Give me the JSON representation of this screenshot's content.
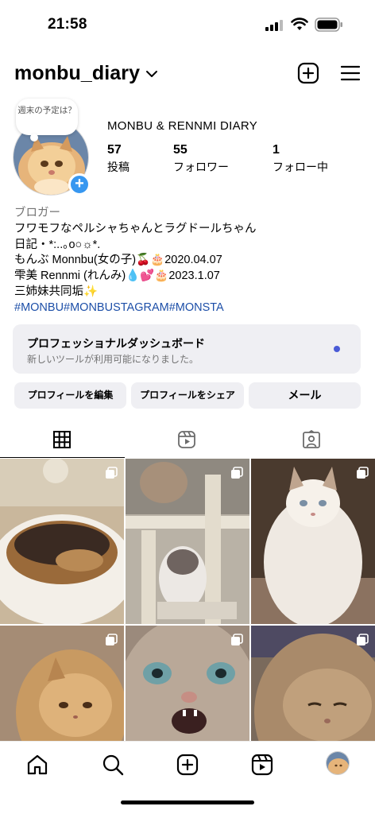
{
  "status_bar": {
    "time": "21:58",
    "icons": [
      "cellular-signal-icon",
      "wifi-icon",
      "battery-icon"
    ]
  },
  "header": {
    "username": "monbu_diary",
    "icons": [
      "chevron-down-icon",
      "plus-square-icon",
      "hamburger-menu-icon"
    ]
  },
  "profile": {
    "note": "週末の予定は？",
    "display_name": "MONBU & RENNMI DIARY",
    "stats": [
      {
        "value": "57",
        "label": "投稿"
      },
      {
        "value": "55",
        "label": "フォロワー"
      },
      {
        "value": "1",
        "label": "フォロー中"
      }
    ]
  },
  "bio": {
    "category": "ブロガー",
    "lines": [
      "フワモフなペルシャちゃんとラグドールちゃん",
      "日記・*:..｡o○☼*.",
      "もんぶ Monnbu(女の子)🍒🎂2020.04.07",
      "雫美 Rennmi (れんみ)💧💕🎂2023.1.07",
      "三姉妹共同垢✨"
    ],
    "hashtags": "#MONBU#MONBUSTAGRAM#MONSTA"
  },
  "dashboard": {
    "title": "プロフェッショナルダッシュボード",
    "subtitle": "新しいツールが利用可能になりました。"
  },
  "buttons": {
    "edit": "プロフィールを編集",
    "share": "プロフィールをシェア",
    "mail": "メール"
  },
  "tabs": [
    "grid-icon",
    "reels-icon",
    "tagged-icon"
  ],
  "grid": [
    {
      "desc": "cat-in-bed",
      "multi": true
    },
    {
      "desc": "cat-tower",
      "multi": true
    },
    {
      "desc": "white-cat",
      "multi": true
    },
    {
      "desc": "orange-cat",
      "multi": true
    },
    {
      "desc": "cat-closeup",
      "multi": true
    },
    {
      "desc": "sleepy-cat",
      "multi": true
    }
  ],
  "bottom_nav": [
    "home-icon",
    "search-icon",
    "create-icon",
    "reels-icon",
    "profile-avatar"
  ]
}
